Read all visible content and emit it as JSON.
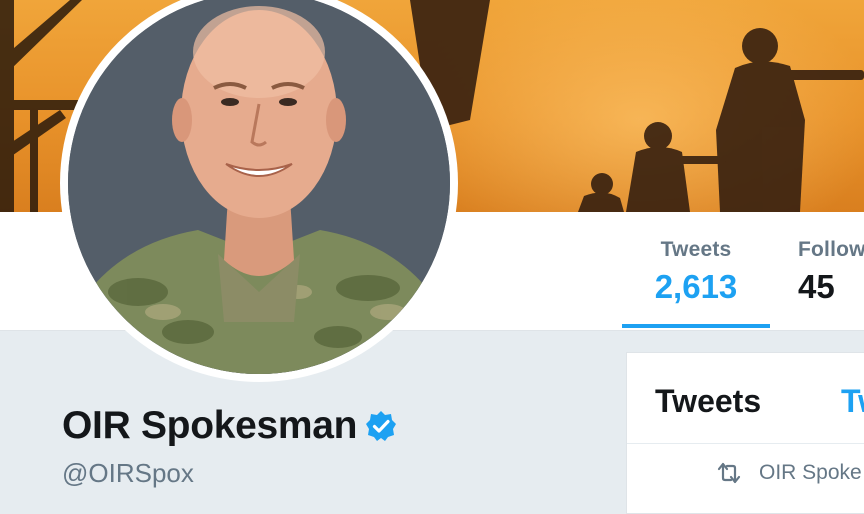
{
  "profile": {
    "name": "OIR Spokesman",
    "handle": "@OIRSpox",
    "verified": true
  },
  "stats": [
    {
      "label": "Tweets",
      "value": "2,613",
      "active": true
    },
    {
      "label": "Follow",
      "value": "45",
      "active": false
    }
  ],
  "timeline": {
    "tabs": [
      "Tweets",
      "Tw"
    ],
    "retweet_notice": "OIR Spoke"
  },
  "colors": {
    "accent": "#1da1f2",
    "text": "#14171a",
    "muted": "#657786",
    "background": "#e6ecf0"
  },
  "icons": [
    "verified-badge-icon",
    "retweet-icon"
  ]
}
